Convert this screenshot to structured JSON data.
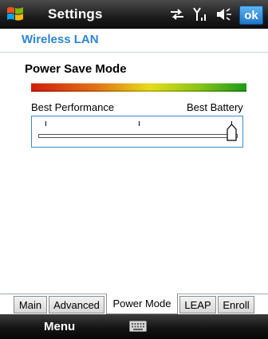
{
  "titlebar": {
    "title": "Settings",
    "ok_label": "ok",
    "icons": [
      "windows-start-icon",
      "connectivity-icon",
      "signal-icon",
      "speaker-icon"
    ]
  },
  "header": {
    "title": "Wireless LAN"
  },
  "power_save": {
    "title": "Power Save Mode",
    "left_label": "Best Performance",
    "right_label": "Best Battery",
    "slider_level": 1.0
  },
  "tabs": [
    {
      "label": "Main",
      "active": false
    },
    {
      "label": "Advanced",
      "active": false
    },
    {
      "label": "Power Mode",
      "active": true
    },
    {
      "label": "LEAP",
      "active": false
    },
    {
      "label": "Enroll",
      "active": false
    }
  ],
  "softkeys": {
    "left_label": "Menu",
    "center_icon": "keyboard-icon"
  },
  "colors": {
    "accent": "#2e84d6",
    "ok_button": "#1e76c9"
  }
}
